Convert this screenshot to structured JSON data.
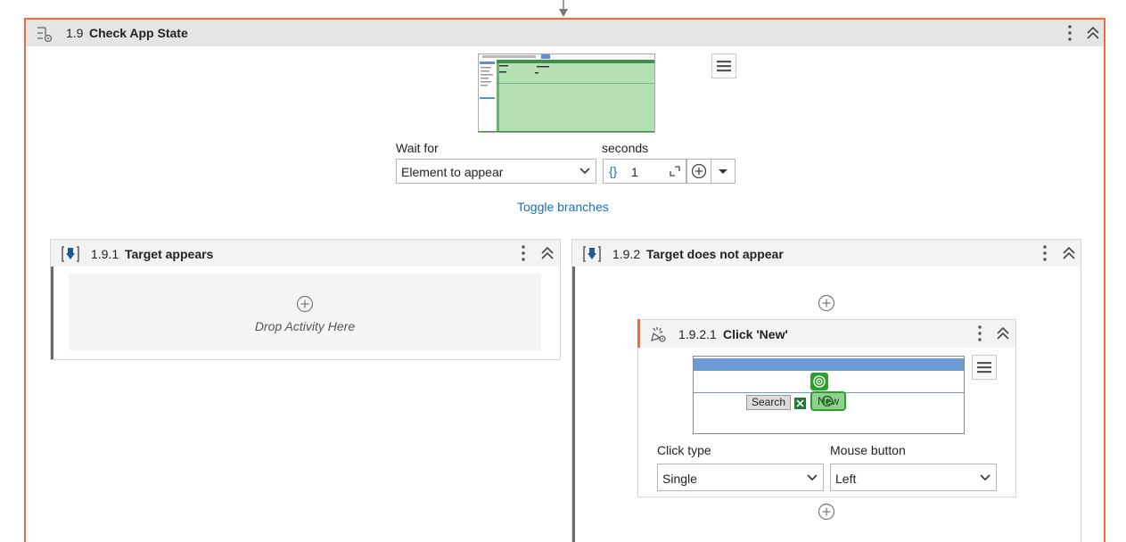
{
  "activity": {
    "number": "1.9",
    "title": "Check App State",
    "wait_for_label": "Wait for",
    "wait_for_value": "Element to appear",
    "seconds_label": "seconds",
    "seconds_value": "1",
    "toggle_link": "Toggle branches"
  },
  "branch_appears": {
    "number": "1.9.1",
    "title": "Target appears",
    "drop_text": "Drop Activity Here"
  },
  "branch_not_appears": {
    "number": "1.9.2",
    "title": "Target does not appear"
  },
  "click": {
    "number": "1.9.2.1",
    "title": "Click 'New'",
    "search_button": "Search",
    "new_button": "New",
    "click_type_label": "Click type",
    "click_type_value": "Single",
    "mouse_button_label": "Mouse button",
    "mouse_button_value": "Left"
  },
  "colors": {
    "accent": "#f26a3c",
    "link": "#1a6fbf",
    "header_bg": "#e5e5e5",
    "target_green": "#2f9e2f"
  }
}
